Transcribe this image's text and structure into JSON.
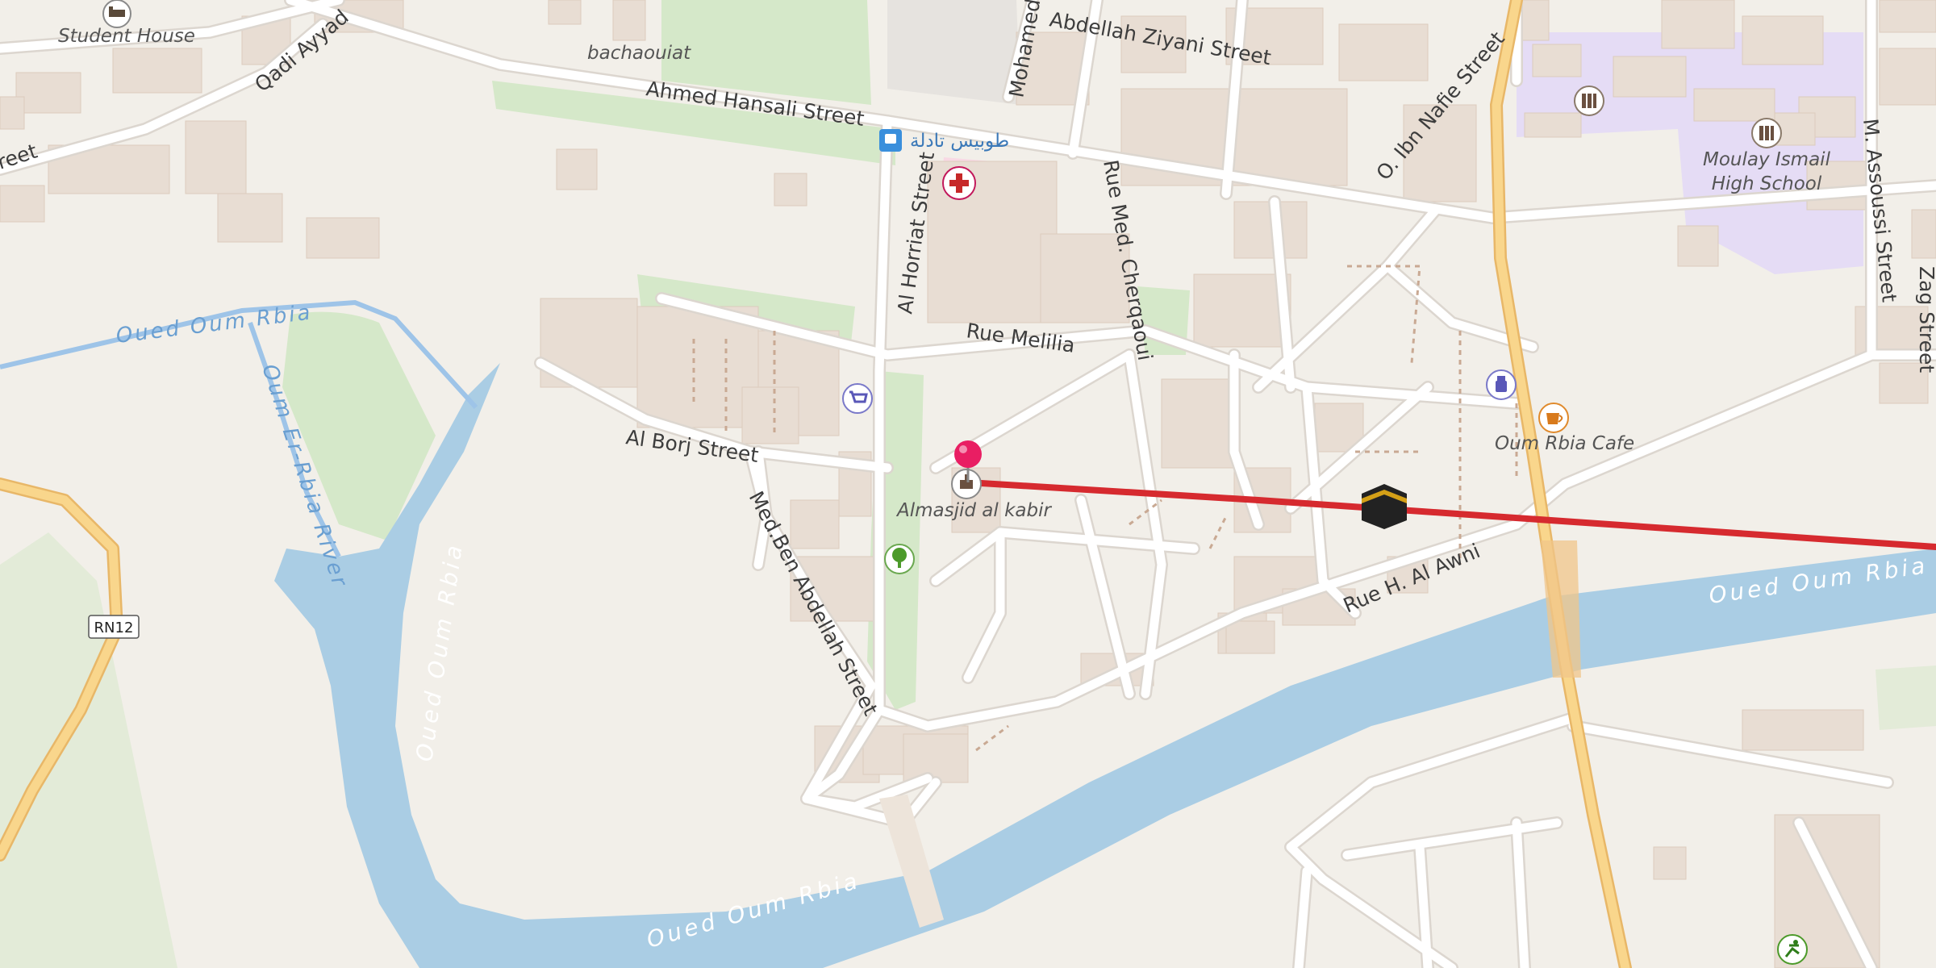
{
  "map": {
    "street_labels": {
      "ahmed_hansali": "Ahmed Hansali Street",
      "abdellah_ziyani": "Abdellah Ziyani Street",
      "mohamed": "Mohamed",
      "qadi_ayyad": "Qadi Ayyad",
      "street_fragment": "reet",
      "o_ibn_nafie": "O. Ibn Nafie Street",
      "al_horriat": "Al Horriat Street",
      "rue_med_cherqaoui": "Rue Med. Cherqaoui",
      "rue_melilia": "Rue Melilia",
      "al_borj": "Al Borj Street",
      "med_ben_abdellah": "Med.Ben Abdellah Street",
      "rue_h_al_awni": "Rue H. Al Awni",
      "m_assoussi": "M. Assoussi Street",
      "zag": "Zag Street"
    },
    "water_labels": {
      "oued_oum_rbia_top": "Oued Oum Rbia",
      "oum_er_rbia_river": "Oum Er-Rbia River",
      "oued_oum_rbia_vertical": "Oued Oum Rbia",
      "oued_oum_rbia_right": "Oued Oum Rbia",
      "oued_oum_rbia_bottom": "Oued Oum Rbia"
    },
    "poi_labels": {
      "student_house": "Student House",
      "bachaouiat": "bachaouiat",
      "bus_station": "طوبيس تادلة",
      "moulay_ismail": "Moulay Ismail\nHigh School",
      "moulay_ismail_l1": "Moulay Ismail",
      "moulay_ismail_l2": "High School",
      "oum_rbia_cafe": "Oum Rbia Cafe",
      "almasjid": "Almasjid al kabir"
    },
    "road_shield": "RN12",
    "colors": {
      "background": "#f2efe9",
      "water": "#aacde4",
      "river_line": "#9ec4e8",
      "park": "#d5e8c9",
      "school_zone": "#e5dcf5",
      "building": "#e8ddd3",
      "road": "#ffffff",
      "road_casing": "#dcd6cf",
      "primary_road": "#f9d68c",
      "primary_casing": "#e8b768",
      "route_line": "#d62a2f",
      "pin": "#e91e63"
    },
    "icons": [
      "student-house-icon",
      "bus-stop-icon",
      "hospital-icon",
      "supermarket-icon",
      "mosque-icon",
      "tree-icon",
      "kaaba-icon",
      "pharmacy-icon",
      "cafe-icon",
      "school-icon",
      "sports-icon",
      "location-pin-icon"
    ]
  }
}
